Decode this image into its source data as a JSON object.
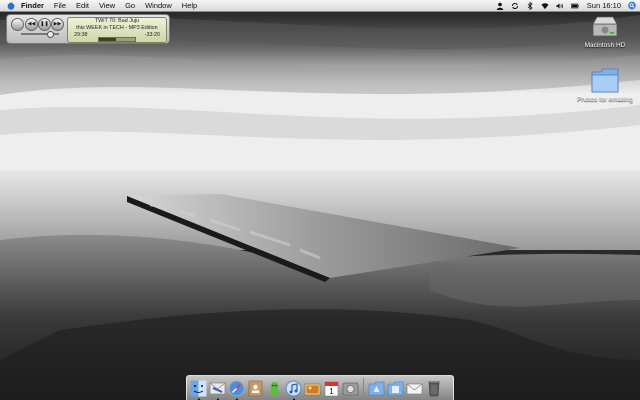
{
  "menubar": {
    "app_name": "Finder",
    "menus": [
      "File",
      "Edit",
      "View",
      "Go",
      "Window",
      "Help"
    ],
    "clock": "Sun 16:10"
  },
  "miniplayer": {
    "track_title": "TWiT 70: Bad Juju",
    "album": "this WEEK in TECH - MP3 Edition",
    "elapsed": "29:38",
    "remaining": "-33:20",
    "progress_fraction": 0.47,
    "volume_fraction": 0.75
  },
  "desktop_icons": [
    {
      "label": "Macintosh HD",
      "icon": "hard-drive-icon"
    },
    {
      "label": "Photos for emailing",
      "icon": "folder-icon"
    }
  ],
  "dock": {
    "apps": [
      {
        "name": "finder-icon",
        "running": true
      },
      {
        "name": "mail-icon",
        "running": true
      },
      {
        "name": "safari-icon",
        "running": true
      },
      {
        "name": "address-book-icon",
        "running": false
      },
      {
        "name": "ichat-icon",
        "running": false
      },
      {
        "name": "itunes-icon",
        "running": true
      },
      {
        "name": "iphoto-icon",
        "running": false
      },
      {
        "name": "ical-icon",
        "running": false
      },
      {
        "name": "system-preferences-icon",
        "running": false
      }
    ],
    "others": [
      {
        "name": "applications-folder-icon"
      },
      {
        "name": "documents-folder-icon"
      },
      {
        "name": "mail-stack-icon"
      },
      {
        "name": "trash-icon"
      }
    ],
    "calendar_day": "1"
  },
  "colors": {
    "menubar_bg": "#e6e6e6",
    "lcd_bg": "#dde3bd"
  }
}
